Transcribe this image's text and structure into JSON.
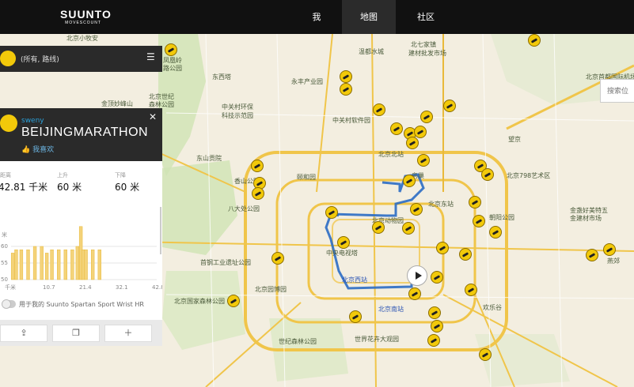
{
  "brand": {
    "name": "SUUNTO",
    "sub": "MOVESCOUNT"
  },
  "nav": [
    {
      "label": "我",
      "active": false
    },
    {
      "label": "地图",
      "active": true
    },
    {
      "label": "社区",
      "active": false
    }
  ],
  "search": {
    "placeholder": "搜索位"
  },
  "filter": {
    "text": "(所有, 路线)"
  },
  "route": {
    "user": "sweny",
    "title": "BEIJINGMARATHON",
    "like": "我喜欢",
    "stats": [
      {
        "label": "距离",
        "value": "42.81 千米"
      },
      {
        "label": "上升",
        "value": "60 米"
      },
      {
        "label": "下降",
        "value": "60 米"
      }
    ],
    "device_label": "用于我的 Suunto Spartan Sport Wrist HR",
    "buttons": [
      {
        "icon": "upload-icon"
      },
      {
        "icon": "copy-icon"
      },
      {
        "icon": "plus-icon"
      }
    ]
  },
  "chart_data": {
    "type": "bar",
    "ylabel": "米",
    "yticks": [
      "60",
      "55",
      "50"
    ],
    "xticks": [
      "千米",
      "10.7",
      "21.4",
      "32.1",
      "42.8"
    ],
    "x": [
      0.5,
      1.5,
      3,
      5,
      7,
      9,
      10.5,
      12,
      14,
      16,
      18,
      19.5,
      20.5,
      21.2,
      22,
      24,
      26,
      27.5
    ],
    "values": [
      58,
      59,
      59,
      59,
      60,
      60,
      58,
      59,
      59,
      59,
      59,
      60,
      66,
      59,
      59,
      59,
      59,
      50
    ],
    "ylim": [
      50,
      70
    ],
    "xlim": [
      0,
      42.8
    ]
  },
  "map": {
    "labels": [
      {
        "text": "北京小牧安"
      },
      {
        "text": "温都水城"
      },
      {
        "text": "北七家镇"
      },
      {
        "text": "建材批发市场"
      },
      {
        "text": "凤凰岭"
      },
      {
        "text": "路公园"
      },
      {
        "text": "东西塔"
      },
      {
        "text": "永丰产业园"
      },
      {
        "text": "金顶妙峰山"
      },
      {
        "text": "北京世纪"
      },
      {
        "text": "森林公园"
      },
      {
        "text": "中关村环保"
      },
      {
        "text": "科技示范园"
      },
      {
        "text": "中关村软件园"
      },
      {
        "text": "北京北站"
      },
      {
        "text": "鸟巢"
      },
      {
        "text": "北京东站"
      },
      {
        "text": "东山贡院"
      },
      {
        "text": "颐和园"
      },
      {
        "text": "香山公园"
      },
      {
        "text": "八大处公园"
      },
      {
        "text": "北京动物园"
      },
      {
        "text": "首钢工业遗址公园"
      },
      {
        "text": "中央电视塔"
      },
      {
        "text": "北京西站"
      },
      {
        "text": "北京南站"
      },
      {
        "text": "北京国家森林公园"
      },
      {
        "text": "北京园博园"
      },
      {
        "text": "世纪森林公园"
      },
      {
        "text": "世界花卉大观园"
      },
      {
        "text": "北京首都国际机场"
      },
      {
        "text": "金盏好美特五"
      },
      {
        "text": "金建材市场"
      },
      {
        "text": "朝阳公园"
      },
      {
        "text": "欢乐谷"
      },
      {
        "text": "北京798艺术区"
      },
      {
        "text": "望京"
      },
      {
        "text": "燕郊"
      }
    ]
  }
}
